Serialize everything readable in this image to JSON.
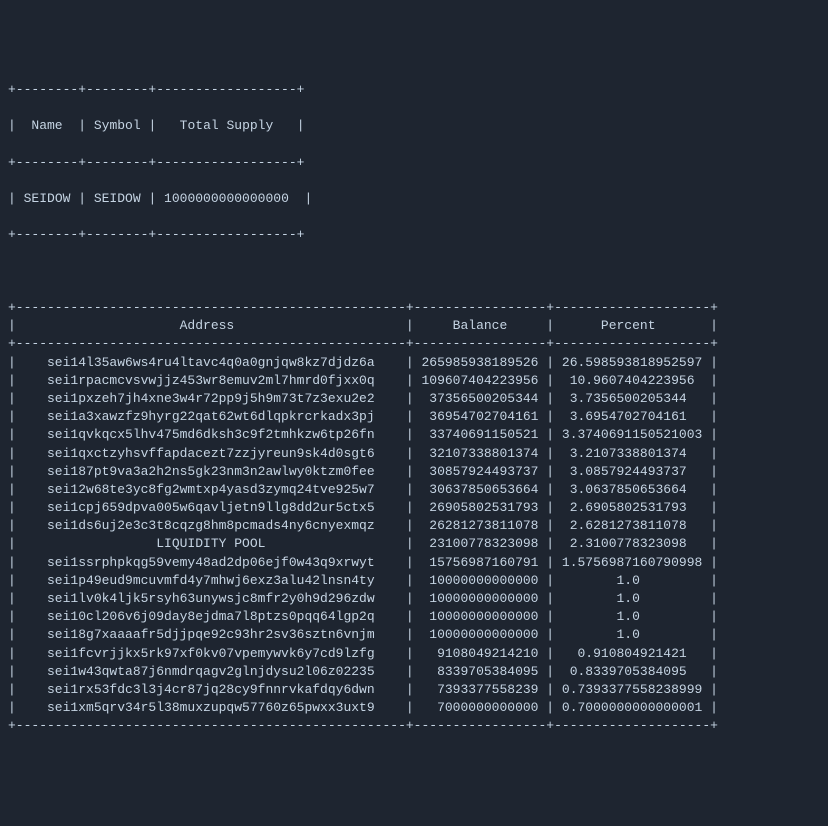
{
  "token_info": {
    "headers": {
      "name": "Name",
      "symbol": "Symbol",
      "total_supply": "Total Supply"
    },
    "data": {
      "name": "SEIDOW",
      "symbol": "SEIDOW",
      "total_supply": "1000000000000000"
    }
  },
  "holders": {
    "headers": {
      "address": "Address",
      "balance": "Balance",
      "percent": "Percent"
    },
    "rows": [
      {
        "address": "sei14l35aw6ws4ru4ltavc4q0a0gnjqw8kz7djdz6a",
        "balance": "265985938189526",
        "percent": "26.598593818952597"
      },
      {
        "address": "sei1rpacmcvsvwjjz453wr8emuv2ml7hmrd0fjxx0q",
        "balance": "109607404223956",
        "percent": "10.9607404223956"
      },
      {
        "address": "sei1pxzeh7jh4xne3w4r72pp9j5h9m73t7z3exu2e2",
        "balance": "37356500205344",
        "percent": "3.7356500205344"
      },
      {
        "address": "sei1a3xawzfz9hyrg22qat62wt6dlqpkrcrkadx3pj",
        "balance": "36954702704161",
        "percent": "3.6954702704161"
      },
      {
        "address": "sei1qvkqcx5lhv475md6dksh3c9f2tmhkzw6tp26fn",
        "balance": "33740691150521",
        "percent": "3.3740691150521003"
      },
      {
        "address": "sei1qxctzyhsvffapdacezt7zzjyreun9sk4d0sgt6",
        "balance": "32107338801374",
        "percent": "3.2107338801374"
      },
      {
        "address": "sei187pt9va3a2h2ns5gk23nm3n2awlwy0ktzm0fee",
        "balance": "30857924493737",
        "percent": "3.0857924493737"
      },
      {
        "address": "sei12w68te3yc8fg2wmtxp4yasd3zymq24tve925w7",
        "balance": "30637850653664",
        "percent": "3.0637850653664"
      },
      {
        "address": "sei1cpj659dpva005w6qavljetn9llg8dd2ur5ctx5",
        "balance": "26905802531793",
        "percent": "2.6905802531793"
      },
      {
        "address": "sei1ds6uj2e3c3t8cqzg8hm8pcmads4ny6cnyexmqz",
        "balance": "26281273811078",
        "percent": "2.6281273811078"
      },
      {
        "address": "LIQUIDITY POOL",
        "balance": "23100778323098",
        "percent": "2.3100778323098"
      },
      {
        "address": "sei1ssrphpkqg59vemy48ad2dp06ejf0w43q9xrwyt",
        "balance": "15756987160791",
        "percent": "1.5756987160790998"
      },
      {
        "address": "sei1p49eud9mcuvmfd4y7mhwj6exz3alu42lnsn4ty",
        "balance": "10000000000000",
        "percent": "1.0"
      },
      {
        "address": "sei1lv0k4ljk5rsyh63unywsjc8mfr2y0h9d296zdw",
        "balance": "10000000000000",
        "percent": "1.0"
      },
      {
        "address": "sei10cl206v6j09day8ejdma7l8ptzs0pqq64lgp2q",
        "balance": "10000000000000",
        "percent": "1.0"
      },
      {
        "address": "sei18g7xaaaafr5djjpqe92c93hr2sv36sztn6vnjm",
        "balance": "10000000000000",
        "percent": "1.0"
      },
      {
        "address": "sei1fcvrjjkx5rk97xf0kv07vpemywvk6y7cd9lzfg",
        "balance": "9108049214210",
        "percent": "0.910804921421"
      },
      {
        "address": "sei1w43qwta87j6nmdrqagv2glnjdysu2l06z02235",
        "balance": "8339705384095",
        "percent": "0.8339705384095"
      },
      {
        "address": "sei1rx53fdc3l3j4cr87jq28cy9fnnrvkafdqy6dwn",
        "balance": "7393377558239",
        "percent": "0.7393377558238999"
      },
      {
        "address": "sei1xm5qrv34r5l38muxzupqw57760z65pwxx3uxt9",
        "balance": "7000000000000",
        "percent": "0.7000000000000001"
      }
    ]
  }
}
